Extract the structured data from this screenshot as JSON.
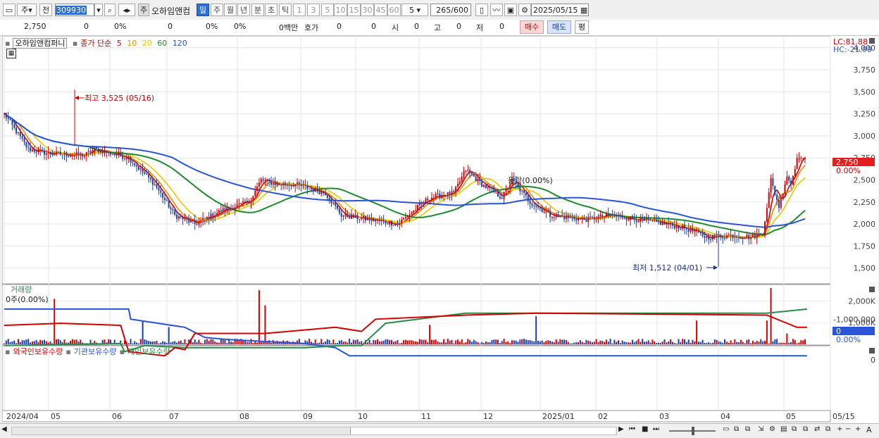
{
  "toolbar": {
    "type_label": "주",
    "prev_label": "전",
    "code": "309930",
    "ju_badge": "주",
    "name": "오하임앤컴",
    "period_tabs": [
      "일",
      "주",
      "월",
      "년",
      "분",
      "초",
      "틱"
    ],
    "intervals": [
      "1",
      "3",
      "5",
      "10",
      "15",
      "30",
      "45",
      "60"
    ],
    "interval_select": "5",
    "count": "265/600",
    "date": "2025/05/15"
  },
  "quote": {
    "price": "2,750",
    "change": "0",
    "change_pct": "0%",
    "volume": "0",
    "vol_pct": "0%",
    "turnover_pct": "0%",
    "amount": "0백만",
    "hoga_label": "호가",
    "hoga1": "0",
    "hoga2": "0",
    "si_label": "시",
    "si_val": "0",
    "go_label": "고",
    "go_val": "0",
    "jeo_label": "저",
    "jeo_val": "0",
    "buy_label": "매수",
    "sell_label": "매도",
    "avg_label": "평"
  },
  "price_panel": {
    "stock_name": "오하임앤컴퍼니",
    "ma_label": "종가 단순",
    "ma_periods": [
      "5",
      "10",
      "20",
      "60",
      "120"
    ],
    "ma_colors": [
      "#d40000",
      "#f08c00",
      "#e8c800",
      "#1e8c2e",
      "#2a55d8"
    ],
    "lc": "LC:81.88",
    "hc": "HC:-21.99",
    "current_price": "2,750",
    "current_pct": "0.00%",
    "high_annotation": "최고 3,525 (05/16)",
    "low_annotation": "최저 1,512 (04/01)",
    "mid_annotation": "등락(0.00%)"
  },
  "volume_panel": {
    "title": "거래량",
    "value": "0주(0.00%)",
    "current": "0",
    "current_pct": "0.00%"
  },
  "holdings_panel": {
    "series": [
      "외국인보유수량",
      "기관보유수량",
      "개인보유수량"
    ],
    "colors": [
      "#d40000",
      "#2a55d8",
      "#2a8c4a"
    ]
  },
  "chart_data": {
    "type": "candlestick",
    "price_axis": {
      "ticks": [
        1500,
        1750,
        2000,
        2250,
        2500,
        2750,
        3000,
        3250,
        3500,
        3750,
        4000
      ],
      "range": [
        1370,
        4070
      ]
    },
    "x_axis_labels": [
      "2024/04",
      "05",
      "06",
      "07",
      "08",
      "09",
      "10",
      "11",
      "12",
      "2025/01",
      "02",
      "03",
      "04",
      "05",
      "05/15"
    ],
    "volume_axis": {
      "ticks": [
        "2,000K",
        "1,000K"
      ]
    },
    "holdings_axis": {
      "ticks": [
        "0",
        "-1,000,000"
      ]
    },
    "high": {
      "value": 3525,
      "date": "05/16"
    },
    "low": {
      "value": 1512,
      "date": "04/01"
    },
    "close_last": 2750,
    "close_anchors": [
      [
        0,
        3250
      ],
      [
        12,
        2850
      ],
      [
        22,
        2800
      ],
      [
        40,
        2780
      ],
      [
        45,
        2850
      ],
      [
        62,
        2750
      ],
      [
        75,
        2450
      ],
      [
        85,
        2100
      ],
      [
        95,
        2000
      ],
      [
        108,
        2150
      ],
      [
        122,
        2250
      ],
      [
        128,
        2500
      ],
      [
        136,
        2450
      ],
      [
        145,
        2450
      ],
      [
        160,
        2350
      ],
      [
        168,
        2100
      ],
      [
        182,
        2050
      ],
      [
        196,
        2000
      ],
      [
        212,
        2300
      ],
      [
        224,
        2350
      ],
      [
        230,
        2620
      ],
      [
        238,
        2450
      ],
      [
        248,
        2300
      ],
      [
        253,
        2500
      ],
      [
        262,
        2250
      ],
      [
        272,
        2100
      ],
      [
        290,
        2050
      ],
      [
        302,
        2100
      ],
      [
        316,
        2050
      ],
      [
        330,
        2000
      ],
      [
        340,
        1950
      ],
      [
        350,
        1850
      ],
      [
        362,
        1870
      ],
      [
        372,
        1850
      ],
      [
        378,
        1900
      ],
      [
        382,
        2500
      ],
      [
        386,
        2200
      ],
      [
        390,
        2550
      ],
      [
        392,
        2450
      ],
      [
        395,
        2750
      ]
    ]
  }
}
